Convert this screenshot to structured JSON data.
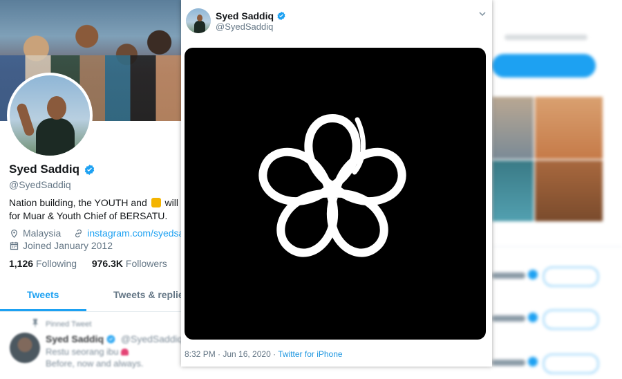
{
  "profile": {
    "name": "Syed Saddiq",
    "handle": "@SyedSaddiq",
    "bio_line1_a": "Nation building, the YOUTH and",
    "bio_line1_b": "will b",
    "bio_line2": "for Muar & Youth Chief of BERSATU.",
    "location": "Malaysia",
    "website": "instagram.com/syedsadd",
    "joined": "Joined January 2012",
    "following_count": "1,126",
    "following_label": "Following",
    "followers_count": "976.3K",
    "followers_label": "Followers"
  },
  "tabs": {
    "tweets": "Tweets",
    "replies": "Tweets & replie"
  },
  "pinned": {
    "label": "Pinned Tweet",
    "name": "Syed Saddiq",
    "handle": "@SyedSaddiq ·",
    "line1": "Restu seorang ibu",
    "line2": "Before, now and always."
  },
  "tweet": {
    "name": "Syed Saddiq",
    "handle": "@SyedSaddiq",
    "timestamp": "8:32 PM · Jun 16, 2020 ·",
    "source": "Twitter for iPhone",
    "media_icon": "five-petal-flower-logo"
  },
  "colors": {
    "accent": "#1da1f2",
    "media_bg": "#000000",
    "logo": "#ffffff"
  }
}
